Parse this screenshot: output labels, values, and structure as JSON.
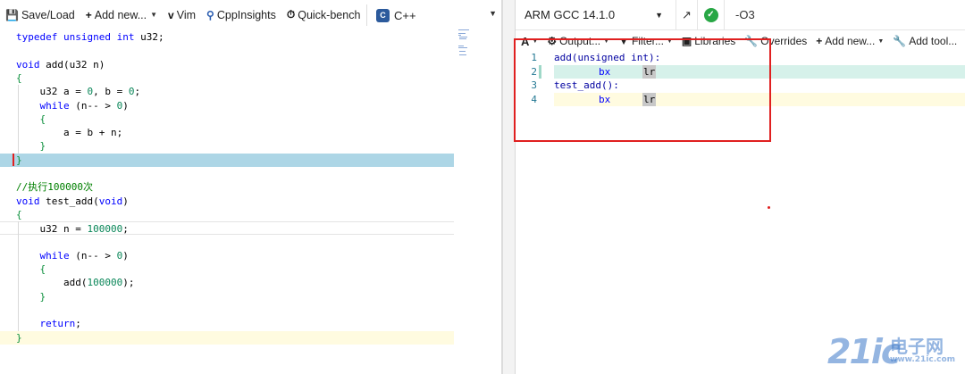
{
  "left_toolbar": {
    "save_load": "Save/Load",
    "add_new": "Add new...",
    "vim": "Vim",
    "cppinsights": "CppInsights",
    "quick_bench": "Quick-bench",
    "language": "C++"
  },
  "source_lines": [
    "typedef unsigned int u32;",
    "",
    "void add(u32 n)",
    "{",
    "    u32 a = 0, b = 0;",
    "    while (n-- > 0)",
    "    {",
    "        a = b + n;",
    "    }",
    "}",
    "",
    "//执行100000次",
    "void test_add(void)",
    "{",
    "    u32 n = 100000;",
    "",
    "    while (n-- > 0)",
    "    {",
    "        add(100000);",
    "    }",
    "",
    "    return;",
    "}"
  ],
  "compiler": {
    "name": "ARM GCC 14.1.0",
    "options": "-O3",
    "status": "ok"
  },
  "right_toolbar": {
    "font": "A",
    "output": "Output...",
    "filter": "Filter...",
    "libraries": "Libraries",
    "overrides": "Overrides",
    "add_new": "Add new...",
    "add_tool": "Add tool..."
  },
  "asm_lines": [
    {
      "no": "1",
      "label": "add(unsigned int):",
      "op": "",
      "reg": ""
    },
    {
      "no": "2",
      "label": "",
      "op": "bx",
      "reg": "lr"
    },
    {
      "no": "3",
      "label": "test_add():",
      "op": "",
      "reg": ""
    },
    {
      "no": "4",
      "label": "",
      "op": "bx",
      "reg": "lr"
    }
  ],
  "watermark": {
    "big": "21ic",
    "cn": "电子网",
    "url": "www.21ic.com"
  },
  "colors": {
    "highlight_blue": "#add6e6",
    "highlight_green": "#d6f1ea",
    "highlight_yellow": "#fffbe0",
    "annotation_red": "#e02020",
    "ok_green": "#28a745"
  }
}
